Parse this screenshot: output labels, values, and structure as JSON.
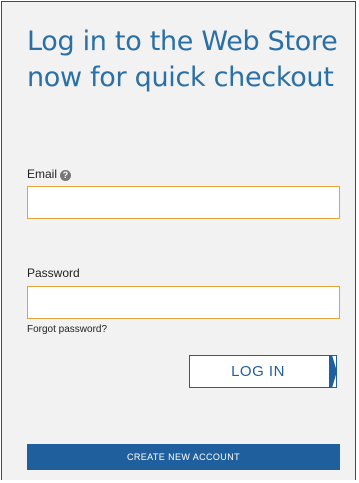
{
  "login_form": {
    "heading": "Log in to the Web Store now for quick checkout",
    "email_label": "Email",
    "email_help_icon": "?",
    "email_value": "",
    "password_label": "Password",
    "password_value": "",
    "forgot_password": "Forgot password?",
    "login_button": "LOG IN",
    "create_account_button": "CREATE NEW ACCOUNT"
  },
  "colors": {
    "heading": "#2a6fa6",
    "primary": "#1f5f9e",
    "input_border": "#e3a43c",
    "panel_background": "#f2f2f2"
  },
  "icons": {
    "email_help": "question-circle-icon",
    "login_chevron": "chevron-right-icon"
  }
}
